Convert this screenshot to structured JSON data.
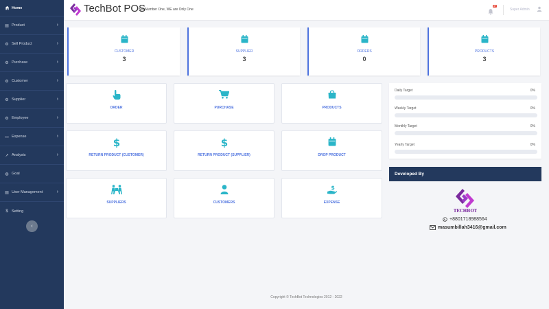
{
  "colors": {
    "sidebar": "#23395d",
    "accent": "#4e73df",
    "icon_teal": "#2ab5c8",
    "badge": "#e74a3b"
  },
  "sidebar": {
    "items": [
      {
        "label": "Home",
        "icon": "home-icon",
        "active": true
      },
      {
        "label": "Product",
        "icon": "box-icon"
      },
      {
        "label": "Sell Product",
        "icon": "cart-icon"
      },
      {
        "label": "Purchase",
        "icon": "purchase-icon"
      },
      {
        "label": "Customer",
        "icon": "customer-icon"
      },
      {
        "label": "Supplier",
        "icon": "supplier-icon"
      },
      {
        "label": "Employee",
        "icon": "employee-icon"
      },
      {
        "label": "Expense",
        "icon": "expense-icon"
      },
      {
        "label": "Analysis",
        "icon": "chart-icon"
      },
      {
        "label": "Goal",
        "icon": "goal-icon"
      },
      {
        "label": "User Management",
        "icon": "users-icon"
      },
      {
        "label": "Setting",
        "icon": "dollar-icon"
      }
    ],
    "collapse_icon": "chevron-left-icon"
  },
  "header": {
    "brand": "TechBot POS",
    "slogan": "Not Number One, WE are Only One",
    "notification_badge": "3+",
    "user_name": "Super Admin"
  },
  "stats": [
    {
      "label": "CUSTOMER",
      "value": "3",
      "icon": "calendar-icon"
    },
    {
      "label": "SUPPLIER",
      "value": "3",
      "icon": "calendar-icon"
    },
    {
      "label": "ORDERS",
      "value": "0",
      "icon": "calendar-icon"
    },
    {
      "label": "PRODUCTS",
      "value": "3",
      "icon": "calendar-icon"
    }
  ],
  "tiles": [
    {
      "label": "ORDER",
      "icon": "hand-pointer-icon"
    },
    {
      "label": "PURCHASE",
      "icon": "cart-icon"
    },
    {
      "label": "PRODUCTS",
      "icon": "shopping-bag-icon"
    },
    {
      "label": "RETURN PRODUCT (CUSTOMER)",
      "icon": "dollar-icon"
    },
    {
      "label": "RETURN PRODUCT (SUPPLIER)",
      "icon": "dollar-icon"
    },
    {
      "label": "DROP PRODUCT",
      "icon": "calendar-icon"
    },
    {
      "label": "SUPPLIERS",
      "icon": "people-carry-icon"
    },
    {
      "label": "CUSTOMERS",
      "icon": "user-icon"
    },
    {
      "label": "EXPENSE",
      "icon": "hand-holding-dollar-icon"
    }
  ],
  "targets": [
    {
      "name": "Daily Target",
      "percent": "0%",
      "progress": 0
    },
    {
      "name": "Weekly Target",
      "percent": "0%",
      "progress": 0
    },
    {
      "name": "Monthly Target",
      "percent": "0%",
      "progress": 0
    },
    {
      "name": "Yearly Target",
      "percent": "0%",
      "progress": 0
    }
  ],
  "developer": {
    "title": "Developed By",
    "phone": "+8801718988564",
    "email": "masumbillah3416@gmail.com"
  },
  "footer": "Copyright © TechBot Technologies 2012 - 2022"
}
